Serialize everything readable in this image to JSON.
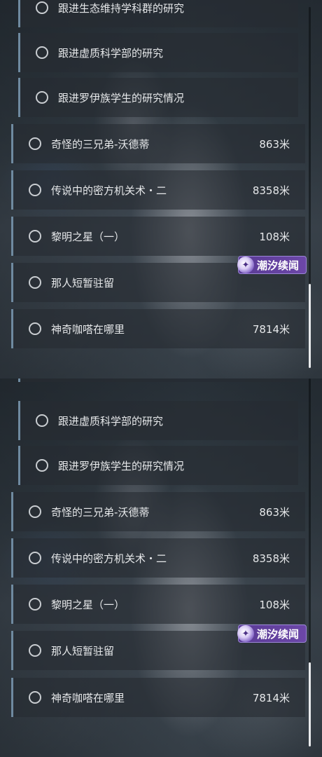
{
  "top_panel": {
    "sub_items": [
      {
        "label": "跟进生态维持学科群的研究"
      },
      {
        "label": "跟进虚质科学部的研究"
      },
      {
        "label": "跟进罗伊族学生的研究情况"
      }
    ],
    "main_items": [
      {
        "label": "奇怪的三兄弟-沃德蒂",
        "distance": "863米"
      },
      {
        "label": "传说中的密方机关术・二",
        "distance": "8358米"
      },
      {
        "label": "黎明之星（一）",
        "distance": "108米"
      },
      {
        "label": "那人短暂驻留",
        "distance": ""
      },
      {
        "label": "神奇咖嗒在哪里",
        "distance": "7814米"
      }
    ],
    "badge": {
      "text": "潮汐续闻",
      "icon": "tide-feather-icon",
      "color": "#6c47a8"
    }
  },
  "bottom_panel": {
    "sub_items": [
      {
        "label": "跟进虚质科学部的研究"
      },
      {
        "label": "跟进罗伊族学生的研究情况"
      }
    ],
    "main_items": [
      {
        "label": "奇怪的三兄弟-沃德蒂",
        "distance": "863米"
      },
      {
        "label": "传说中的密方机关术・二",
        "distance": "8358米"
      },
      {
        "label": "黎明之星（一）",
        "distance": "108米"
      },
      {
        "label": "那人短暂驻留",
        "distance": ""
      },
      {
        "label": "神奇咖嗒在哪里",
        "distance": "7814米"
      }
    ],
    "badge": {
      "text": "潮汐续闻",
      "icon": "tide-feather-icon",
      "color": "#6c47a8"
    }
  },
  "colors": {
    "accent_bar": "#6f8aa0",
    "item_text": "#e6e8ea",
    "badge_purple": "#6c47a8"
  }
}
